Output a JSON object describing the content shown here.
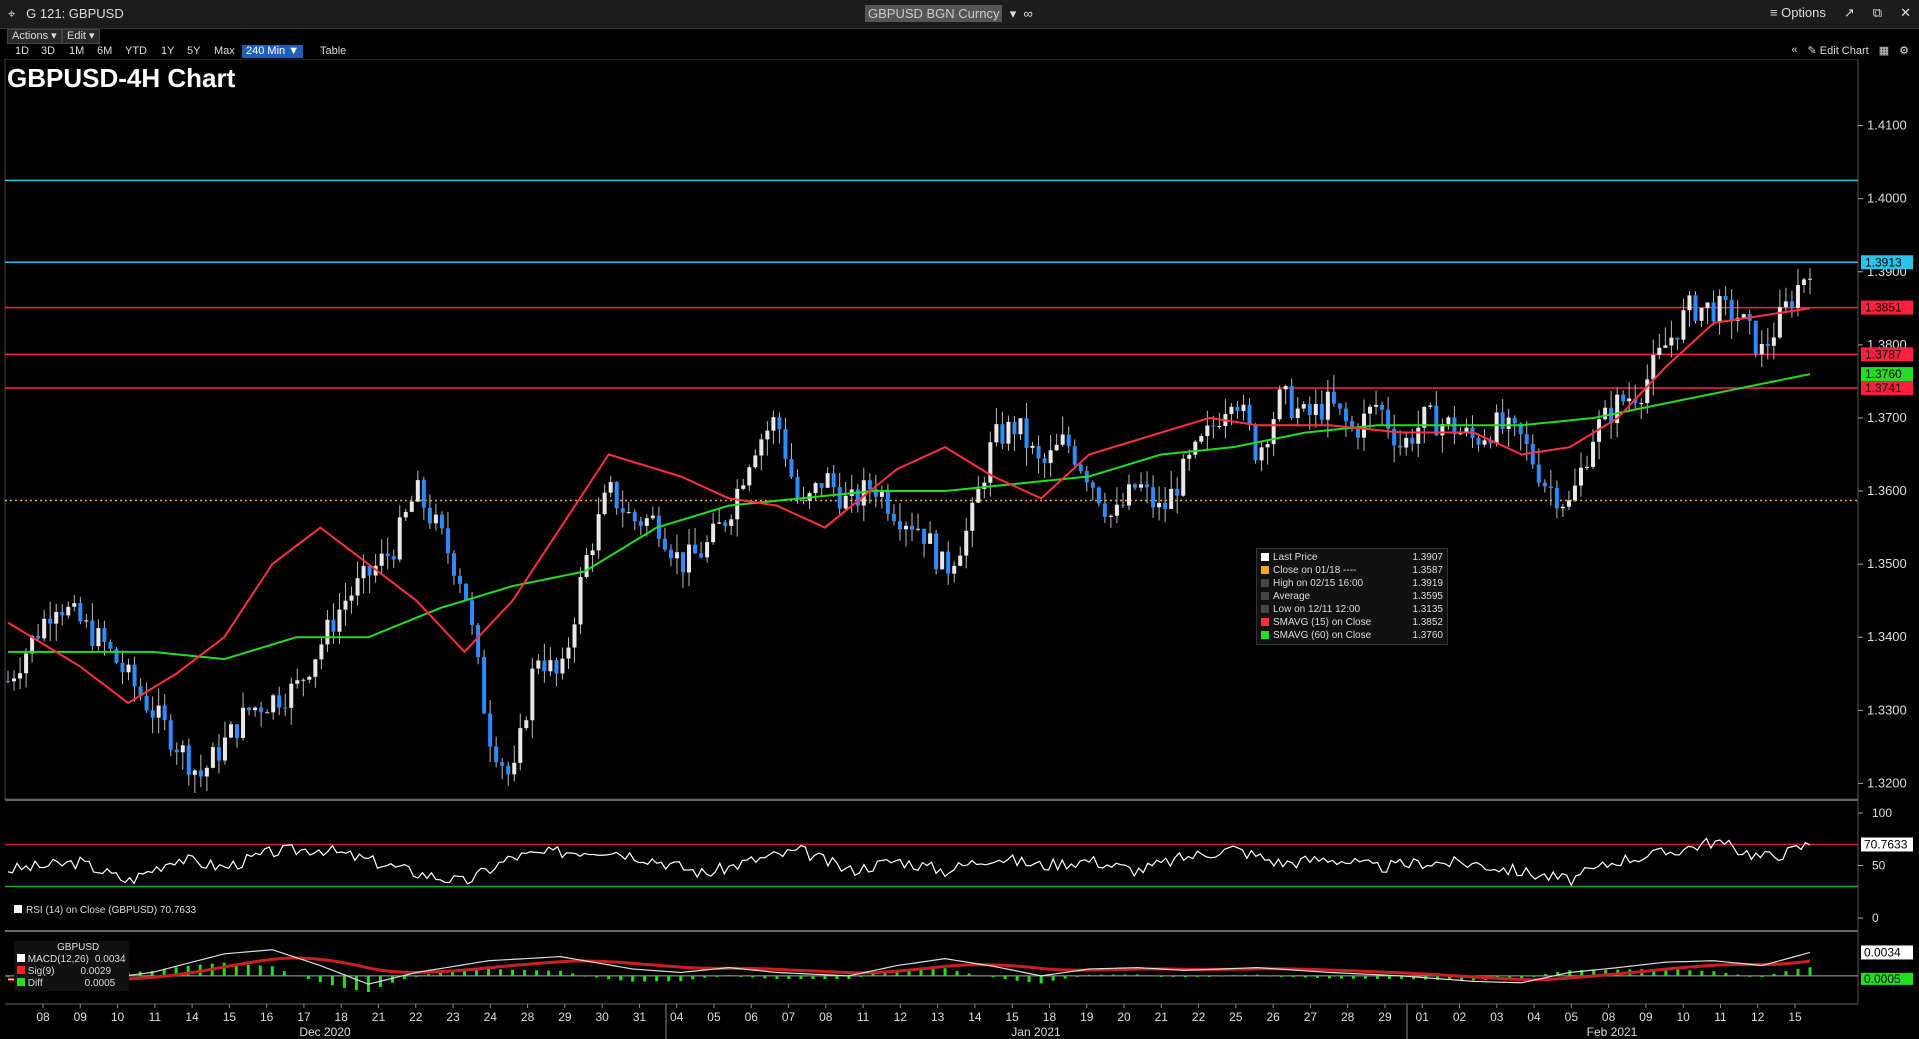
{
  "window": {
    "app_label": "G 121: GBPUSD",
    "security": "GBPUSD BGN Curncy",
    "options_label": "Options"
  },
  "menu": {
    "actions_label": "Actions",
    "edit_label": "Edit"
  },
  "ranges": [
    "1D",
    "3D",
    "1M",
    "6M",
    "YTD",
    "1Y",
    "5Y",
    "Max"
  ],
  "active_range": "240 Min",
  "table_label": "Table",
  "edit_chart_label": "Edit Chart",
  "chart_title": "GBPUSD-4H Chart",
  "legend": {
    "rows": [
      {
        "label": "Last Price",
        "value": "1.3907",
        "color": "#ffffff"
      },
      {
        "label": "Close on 01/18 ----",
        "value": "1.3587",
        "color": "#f5a623"
      },
      {
        "label": "High on 02/15 16:00",
        "value": "1.3919",
        "color": "#999999"
      },
      {
        "label": "Average",
        "value": "1.3595",
        "color": "#999999"
      },
      {
        "label": "Low on 12/11 12:00",
        "value": "1.3135",
        "color": "#999999"
      },
      {
        "label": "SMAVG (15)  on Close",
        "value": "1.3852",
        "color": "#ff3040"
      },
      {
        "label": "SMAVG (60)  on Close",
        "value": "1.3760",
        "color": "#22dd22"
      }
    ]
  },
  "rsi_label": "RSI (14)  on Close (GBPUSD) 70.7633",
  "macd": {
    "title": "GBPUSD",
    "rows": [
      {
        "label": "MACD(12,26)",
        "value": "0.0034",
        "color": "#ffffff"
      },
      {
        "label": "Sig(9)",
        "value": "0.0029",
        "color": "#ff2020"
      },
      {
        "label": "Diff",
        "value": "0.0005",
        "color": "#22dd22"
      }
    ]
  },
  "chart_data": [
    {
      "type": "candlestick",
      "title": "GBPUSD-4H Chart",
      "ylim": [
        1.318,
        1.4135
      ],
      "yticks": [
        "1.4100",
        "1.4000",
        "1.3900",
        "1.3800",
        "1.3700",
        "1.3600",
        "1.3500",
        "1.3400",
        "1.3300",
        "1.3200"
      ],
      "x_tick_labels": [
        "08",
        "09",
        "10",
        "11",
        "14",
        "15",
        "16",
        "17",
        "18",
        "21",
        "22",
        "23",
        "24",
        "28",
        "29",
        "30",
        "31",
        "04",
        "05",
        "06",
        "07",
        "08",
        "11",
        "12",
        "13",
        "14",
        "15",
        "18",
        "19",
        "20",
        "21",
        "22",
        "25",
        "26",
        "27",
        "28",
        "29",
        "01",
        "02",
        "03",
        "04",
        "05",
        "08",
        "09",
        "10",
        "11",
        "12",
        "15"
      ],
      "month_labels": [
        "Dec 2020",
        "Jan 2021",
        "Feb 2021"
      ],
      "horizontal_lines": [
        {
          "value": 1.4025,
          "color": "#29c5e6"
        },
        {
          "value": 1.3913,
          "color": "#29c5e6",
          "label": "1.3913"
        },
        {
          "value": 1.3851,
          "color": "#ff2040",
          "label": "1.3851"
        },
        {
          "value": 1.3787,
          "color": "#ff2040",
          "label": "1.3787"
        },
        {
          "value": 1.3741,
          "color": "#ff2040",
          "label": "1.3741"
        },
        {
          "value": 1.3587,
          "color": "#f5a623",
          "style": "dotted"
        }
      ],
      "badges": [
        {
          "label": "1.3913",
          "value": 1.3913,
          "color": "#29c5e6"
        },
        {
          "label": "1.3851",
          "value": 1.3851,
          "color": "#ff2040"
        },
        {
          "label": "1.3787",
          "value": 1.3787,
          "color": "#ff2040"
        },
        {
          "label": "1.3760",
          "value": 1.376,
          "color": "#22dd22"
        },
        {
          "label": "1.3741",
          "value": 1.3741,
          "color": "#ff2040"
        }
      ],
      "close_path": [
        [
          0,
          1.334
        ],
        [
          2,
          1.345
        ],
        [
          4,
          1.339
        ],
        [
          6,
          1.33
        ],
        [
          8,
          1.321
        ],
        [
          10,
          1.33
        ],
        [
          12,
          1.333
        ],
        [
          14,
          1.345
        ],
        [
          16,
          1.352
        ],
        [
          17,
          1.36
        ],
        [
          18,
          1.354
        ],
        [
          19,
          1.347
        ],
        [
          20,
          1.327
        ],
        [
          21,
          1.32
        ],
        [
          22,
          1.338
        ],
        [
          23,
          1.334
        ],
        [
          24,
          1.35
        ],
        [
          25,
          1.36
        ],
        [
          26,
          1.356
        ],
        [
          27,
          1.356
        ],
        [
          28,
          1.35
        ],
        [
          29,
          1.352
        ],
        [
          30,
          1.357
        ],
        [
          31,
          1.366
        ],
        [
          32,
          1.37
        ],
        [
          33,
          1.357
        ],
        [
          34,
          1.362
        ],
        [
          35,
          1.358
        ],
        [
          36,
          1.361
        ],
        [
          37,
          1.357
        ],
        [
          38,
          1.355
        ],
        [
          39,
          1.349
        ],
        [
          40,
          1.355
        ],
        [
          41,
          1.367
        ],
        [
          42,
          1.369
        ],
        [
          43,
          1.363
        ],
        [
          44,
          1.367
        ],
        [
          45,
          1.362
        ],
        [
          46,
          1.356
        ],
        [
          47,
          1.361
        ],
        [
          48,
          1.357
        ],
        [
          49,
          1.363
        ],
        [
          50,
          1.368
        ],
        [
          51,
          1.374
        ],
        [
          52,
          1.365
        ],
        [
          53,
          1.373
        ],
        [
          54,
          1.37
        ],
        [
          55,
          1.372
        ],
        [
          56,
          1.368
        ],
        [
          57,
          1.372
        ],
        [
          58,
          1.366
        ],
        [
          59,
          1.37
        ],
        [
          60,
          1.369
        ],
        [
          61,
          1.367
        ],
        [
          62,
          1.369
        ],
        [
          63,
          1.367
        ],
        [
          64,
          1.361
        ],
        [
          65,
          1.358
        ],
        [
          66,
          1.368
        ],
        [
          67,
          1.372
        ],
        [
          68,
          1.374
        ],
        [
          69,
          1.38
        ],
        [
          70,
          1.385
        ],
        [
          71,
          1.385
        ],
        [
          72,
          1.384
        ],
        [
          73,
          1.379
        ],
        [
          74,
          1.385
        ],
        [
          75,
          1.391
        ]
      ],
      "sma15_path": [
        [
          0,
          1.342
        ],
        [
          3,
          1.336
        ],
        [
          5,
          1.331
        ],
        [
          7,
          1.335
        ],
        [
          9,
          1.34
        ],
        [
          11,
          1.35
        ],
        [
          13,
          1.355
        ],
        [
          15,
          1.35
        ],
        [
          17,
          1.345
        ],
        [
          19,
          1.338
        ],
        [
          21,
          1.345
        ],
        [
          23,
          1.355
        ],
        [
          25,
          1.365
        ],
        [
          28,
          1.362
        ],
        [
          30,
          1.359
        ],
        [
          32,
          1.358
        ],
        [
          34,
          1.355
        ],
        [
          37,
          1.363
        ],
        [
          39,
          1.366
        ],
        [
          41,
          1.362
        ],
        [
          43,
          1.359
        ],
        [
          45,
          1.365
        ],
        [
          48,
          1.368
        ],
        [
          50,
          1.37
        ],
        [
          52,
          1.369
        ],
        [
          55,
          1.369
        ],
        [
          58,
          1.368
        ],
        [
          61,
          1.368
        ],
        [
          63,
          1.365
        ],
        [
          65,
          1.366
        ],
        [
          67,
          1.37
        ],
        [
          69,
          1.377
        ],
        [
          71,
          1.383
        ],
        [
          73,
          1.384
        ],
        [
          75,
          1.385
        ]
      ],
      "sma60_path": [
        [
          0,
          1.338
        ],
        [
          6,
          1.338
        ],
        [
          9,
          1.337
        ],
        [
          12,
          1.34
        ],
        [
          15,
          1.34
        ],
        [
          18,
          1.344
        ],
        [
          21,
          1.347
        ],
        [
          24,
          1.349
        ],
        [
          27,
          1.355
        ],
        [
          30,
          1.358
        ],
        [
          33,
          1.359
        ],
        [
          36,
          1.36
        ],
        [
          39,
          1.36
        ],
        [
          42,
          1.361
        ],
        [
          45,
          1.362
        ],
        [
          48,
          1.365
        ],
        [
          51,
          1.366
        ],
        [
          54,
          1.368
        ],
        [
          57,
          1.369
        ],
        [
          60,
          1.369
        ],
        [
          63,
          1.369
        ],
        [
          66,
          1.37
        ],
        [
          69,
          1.372
        ],
        [
          72,
          1.374
        ],
        [
          75,
          1.376
        ]
      ]
    },
    {
      "type": "line",
      "title": "RSI (14) on Close (GBPUSD)",
      "ylim": [
        0,
        100
      ],
      "yticks": [
        "100",
        "50",
        "0"
      ],
      "reference_lines": [
        70,
        30
      ],
      "last_value_label": "70.7633",
      "values_path": [
        [
          0,
          46
        ],
        [
          3,
          53
        ],
        [
          5,
          35
        ],
        [
          7,
          57
        ],
        [
          9,
          48
        ],
        [
          11,
          63
        ],
        [
          13,
          66
        ],
        [
          15,
          55
        ],
        [
          17,
          43
        ],
        [
          19,
          34
        ],
        [
          21,
          58
        ],
        [
          23,
          63
        ],
        [
          25,
          65
        ],
        [
          27,
          55
        ],
        [
          29,
          42
        ],
        [
          31,
          55
        ],
        [
          33,
          64
        ],
        [
          35,
          45
        ],
        [
          37,
          55
        ],
        [
          39,
          45
        ],
        [
          41,
          58
        ],
        [
          43,
          50
        ],
        [
          45,
          55
        ],
        [
          47,
          45
        ],
        [
          49,
          58
        ],
        [
          51,
          66
        ],
        [
          53,
          52
        ],
        [
          55,
          57
        ],
        [
          57,
          48
        ],
        [
          59,
          53
        ],
        [
          61,
          52
        ],
        [
          63,
          44
        ],
        [
          65,
          36
        ],
        [
          67,
          55
        ],
        [
          69,
          62
        ],
        [
          71,
          73
        ],
        [
          73,
          58
        ],
        [
          74,
          62
        ],
        [
          75,
          70.76
        ]
      ]
    },
    {
      "type": "line",
      "title": "MACD",
      "ylim": [
        -0.0035,
        0.0055
      ],
      "series": [
        {
          "name": "MACD(12,26)",
          "last": 0.0034
        },
        {
          "name": "Sig(9)",
          "last": 0.0029
        },
        {
          "name": "Diff",
          "last": 0.0005
        }
      ],
      "macd_path": [
        [
          0,
          -0.0005
        ],
        [
          3,
          -0.0008
        ],
        [
          6,
          0.0005
        ],
        [
          9,
          0.0032
        ],
        [
          11,
          0.0038
        ],
        [
          13,
          0.0015
        ],
        [
          15,
          -0.0012
        ],
        [
          17,
          0.0005
        ],
        [
          20,
          0.0022
        ],
        [
          23,
          0.0028
        ],
        [
          26,
          0.001
        ],
        [
          28,
          0.0005
        ],
        [
          30,
          0.0012
        ],
        [
          32,
          0.0005
        ],
        [
          35,
          0.0
        ],
        [
          37,
          0.0015
        ],
        [
          39,
          0.0025
        ],
        [
          41,
          0.0014
        ],
        [
          43,
          0.0
        ],
        [
          45,
          0.001
        ],
        [
          47,
          0.0012
        ],
        [
          49,
          0.0008
        ],
        [
          52,
          0.0012
        ],
        [
          55,
          0.0005
        ],
        [
          58,
          0.0
        ],
        [
          61,
          -0.0008
        ],
        [
          63,
          -0.001
        ],
        [
          65,
          0.0005
        ],
        [
          67,
          0.0012
        ],
        [
          69,
          0.002
        ],
        [
          71,
          0.0022
        ],
        [
          73,
          0.0015
        ],
        [
          75,
          0.0034
        ]
      ],
      "x_range": [
        0,
        75
      ],
      "upper_label": "0.0034",
      "lower_label": "0.0005"
    }
  ]
}
